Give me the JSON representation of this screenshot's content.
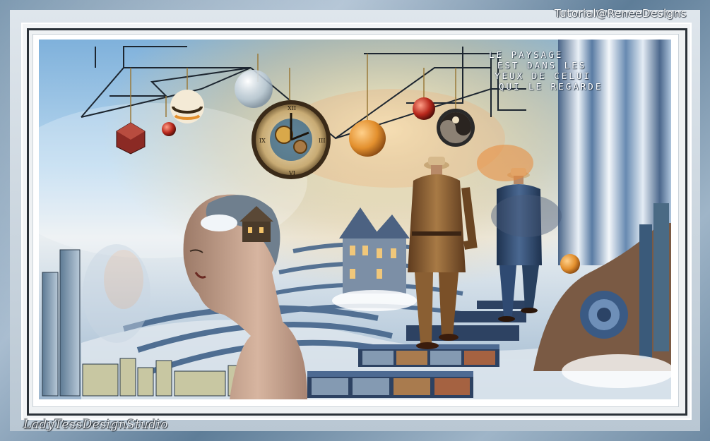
{
  "artwork": {
    "overlay_lines": [
      "LE PAYSAGE",
      "EST DANS LES",
      "YEUX DE CELUI",
      "QUI LE REGARDE"
    ],
    "top_credit": "Tutorial@ReneeDesigns",
    "bottom_credit": "LadyTessDesignStudio"
  },
  "colors": {
    "frame_blue": "#6f8ea8",
    "sky_blue": "#7fb1db",
    "suit_brown": "#8a5f33",
    "suit_blue": "#2f4a72",
    "accent_orange": "#e3902e"
  },
  "icons": {
    "clock": "clock-icon",
    "spheres": "sphere-ornament"
  }
}
